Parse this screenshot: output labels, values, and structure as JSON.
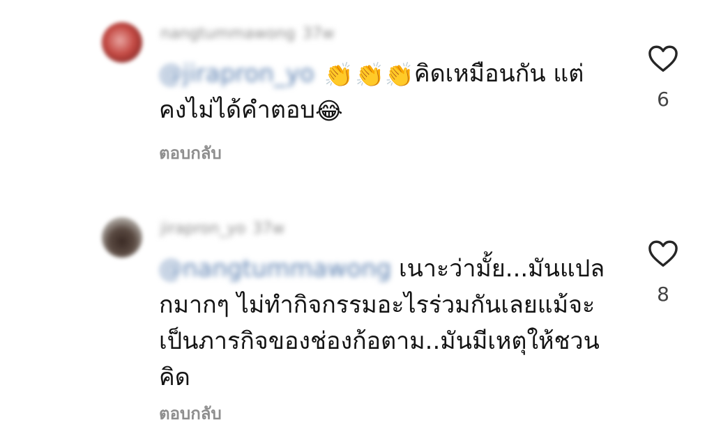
{
  "comments": [
    {
      "username": "nangtummawong",
      "time": "37w",
      "mention": "@jirapron_yo",
      "emojis": [
        "👏",
        "👏",
        "👏"
      ],
      "line1_text": "คิดเหมือนกัน แต่",
      "line2_text": "คงไม่ได้คำตอบ",
      "trailing_emoji": "😂",
      "reply_label": "ตอบกลับ",
      "like_icon": "heart-outline-icon",
      "like_count": "6"
    },
    {
      "username": "jirapron_yo",
      "time": "37w",
      "mention": "@nangtummawong",
      "line1_text": " เนาะว่ามั้ย...มันแปล",
      "line2_text": "กมากๆ ไม่ทำกิจกรรมอะไรร่วมกันเลยแม้จะ",
      "line3_text": "เป็นภารกิจของช่องก้อตาม..มันมีเหตุให้ชวน",
      "line4_text": "คิด",
      "reply_label": "ตอบกลับ",
      "like_icon": "heart-outline-icon",
      "like_count": "8"
    }
  ]
}
